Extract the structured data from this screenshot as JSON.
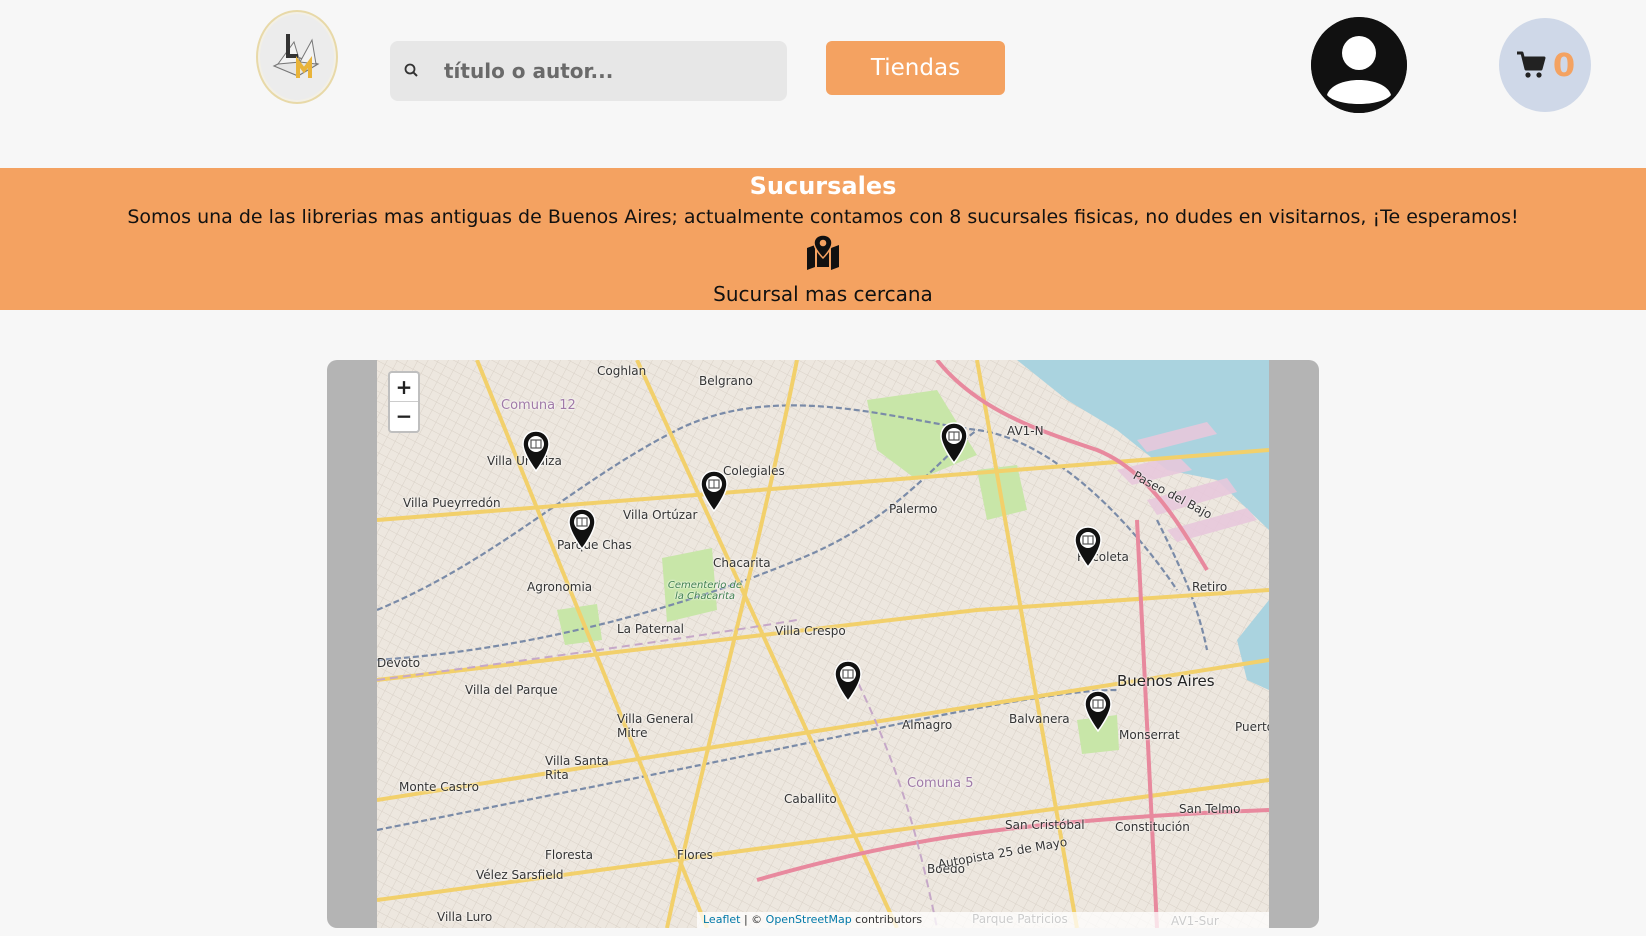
{
  "header": {
    "logo_letters": "LM",
    "search": {
      "placeholder": "título o autor..."
    },
    "tiendas_label": "Tiendas",
    "cart_count": "0",
    "icons": {
      "search": "search-icon",
      "avatar": "user-circle-icon",
      "cart": "cart-icon"
    }
  },
  "banner": {
    "title": "Sucursales",
    "text": "Somos una de las librerias mas antiguas de Buenos Aires; actualmente contamos con 8 sucursales fisicas, no dudes en visitarnos, ¡Te esperamos!",
    "icon": "map-location-icon",
    "subtitle": "Sucursal mas cercana"
  },
  "map": {
    "zoom_in": "+",
    "zoom_out": "−",
    "attribution": {
      "leaflet": "Leaflet",
      "sep": " | © ",
      "osm": "OpenStreetMap",
      "suffix": " contributors"
    },
    "places": [
      "Coghlan",
      "Belgrano",
      "Comuna 12",
      "Villa Urquiza",
      "Colegiales",
      "Villa Pueyrredón",
      "Palermo",
      "Villa Ortúzar",
      "Parque Chas",
      "Chacarita",
      "Recoleta",
      "Agronomia",
      "Cementerio de la Chacarita",
      "Retiro",
      "La Paternal",
      "Villa Crespo",
      "Devoto",
      "Villa del Parque",
      "Buenos Aires",
      "Villa General Mitre",
      "Almagro",
      "Balvanera",
      "Monserrat",
      "Puerto",
      "Villa Santa Rita",
      "Monte Castro",
      "Comuna 5",
      "Caballito",
      "San Telmo",
      "San Cristóbal",
      "Constitución",
      "Floresta",
      "Flores",
      "Vélez Sarsfield",
      "Boedo",
      "Villa Luro",
      "Parque Patricios",
      "AV1-N",
      "AV1-Sur",
      "Paseo del Bajo",
      "Autopista 25 de Mayo"
    ],
    "marker_count": 8
  },
  "colors": {
    "accent": "#f4a261",
    "cart_bg": "#cfd8e8",
    "map_frame": "#b4b4b4",
    "water": "#aad3df",
    "park": "#c8e6a8",
    "major_road": "#f2d06b",
    "rail": "#7a8ba8"
  }
}
